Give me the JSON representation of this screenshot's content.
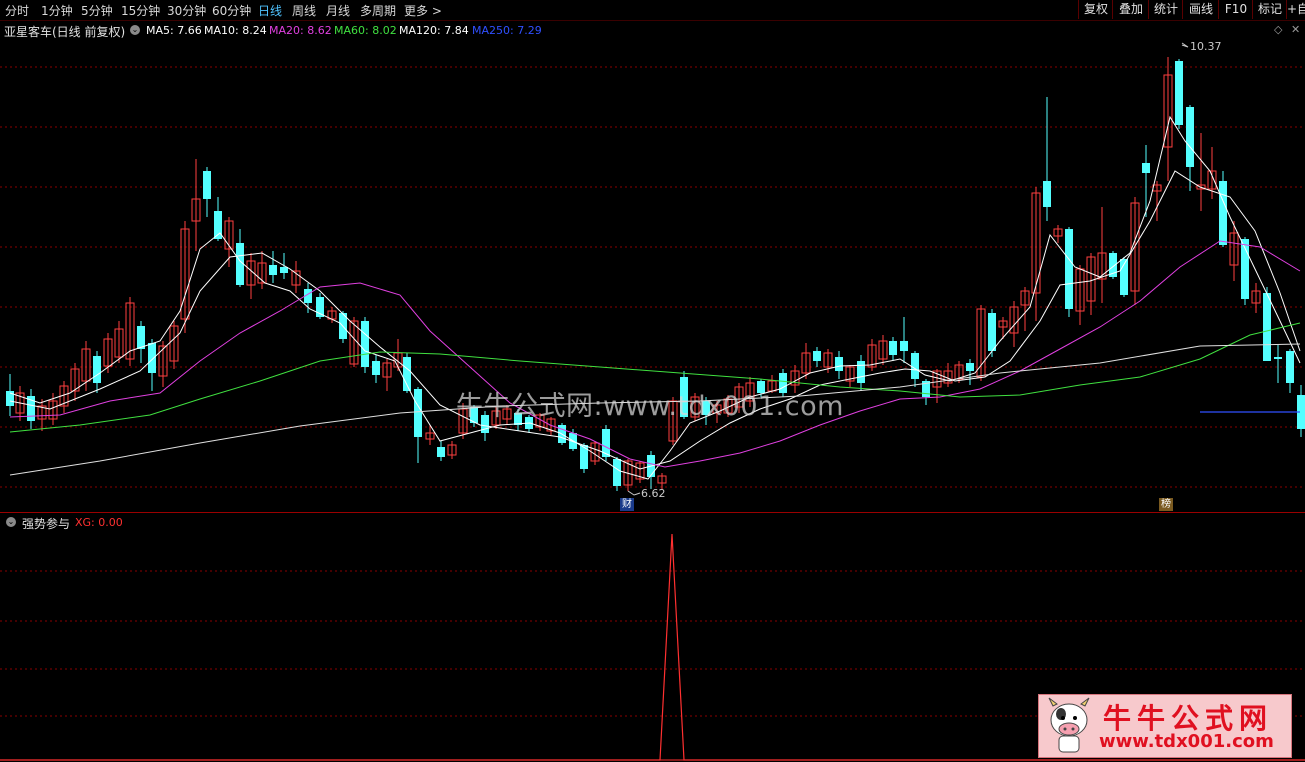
{
  "toolbar": {
    "periods": [
      "分时",
      "1分钟",
      "5分钟",
      "15分钟",
      "30分钟",
      "60分钟",
      "日线",
      "周线",
      "月线",
      "多周期",
      "更多 >"
    ],
    "active_period": "日线",
    "buttons": [
      "复权",
      "叠加",
      "统计",
      "画线",
      "F10",
      "标记",
      "+自"
    ]
  },
  "main": {
    "stock_title": "亚星客车(日线 前复权)",
    "ma": [
      {
        "label": "MA5: 7.66",
        "color": "#ffffff"
      },
      {
        "label": "MA10: 8.24",
        "color": "#ffffff"
      },
      {
        "label": "MA20: 8.62",
        "color": "#e040e0"
      },
      {
        "label": "MA60: 8.02",
        "color": "#40e040"
      },
      {
        "label": "MA120: 7.84",
        "color": "#ffffff"
      },
      {
        "label": "MA250: 7.29",
        "color": "#3050ff"
      }
    ],
    "high_label": "10.37",
    "low_label": "6.62",
    "tag_cai": "财",
    "tag_bang": "榜",
    "colors": {
      "up": "#ff4040",
      "down": "#54ffff",
      "ma5": "#ffffff",
      "ma10": "#ffffff",
      "ma20": "#e040e0",
      "ma60": "#40e040",
      "ma120": "#e0e0e0",
      "ma250": "#3050ff",
      "grid": "#8a0000"
    }
  },
  "indicator": {
    "name": "强势参与",
    "value_label": "XG: 0.00",
    "value_color": "#ff3030"
  },
  "watermark": {
    "center": "牛牛公式网:www.tdx001.com",
    "corner_title": "牛牛公式网",
    "corner_url": "www.tdx001.com"
  }
}
